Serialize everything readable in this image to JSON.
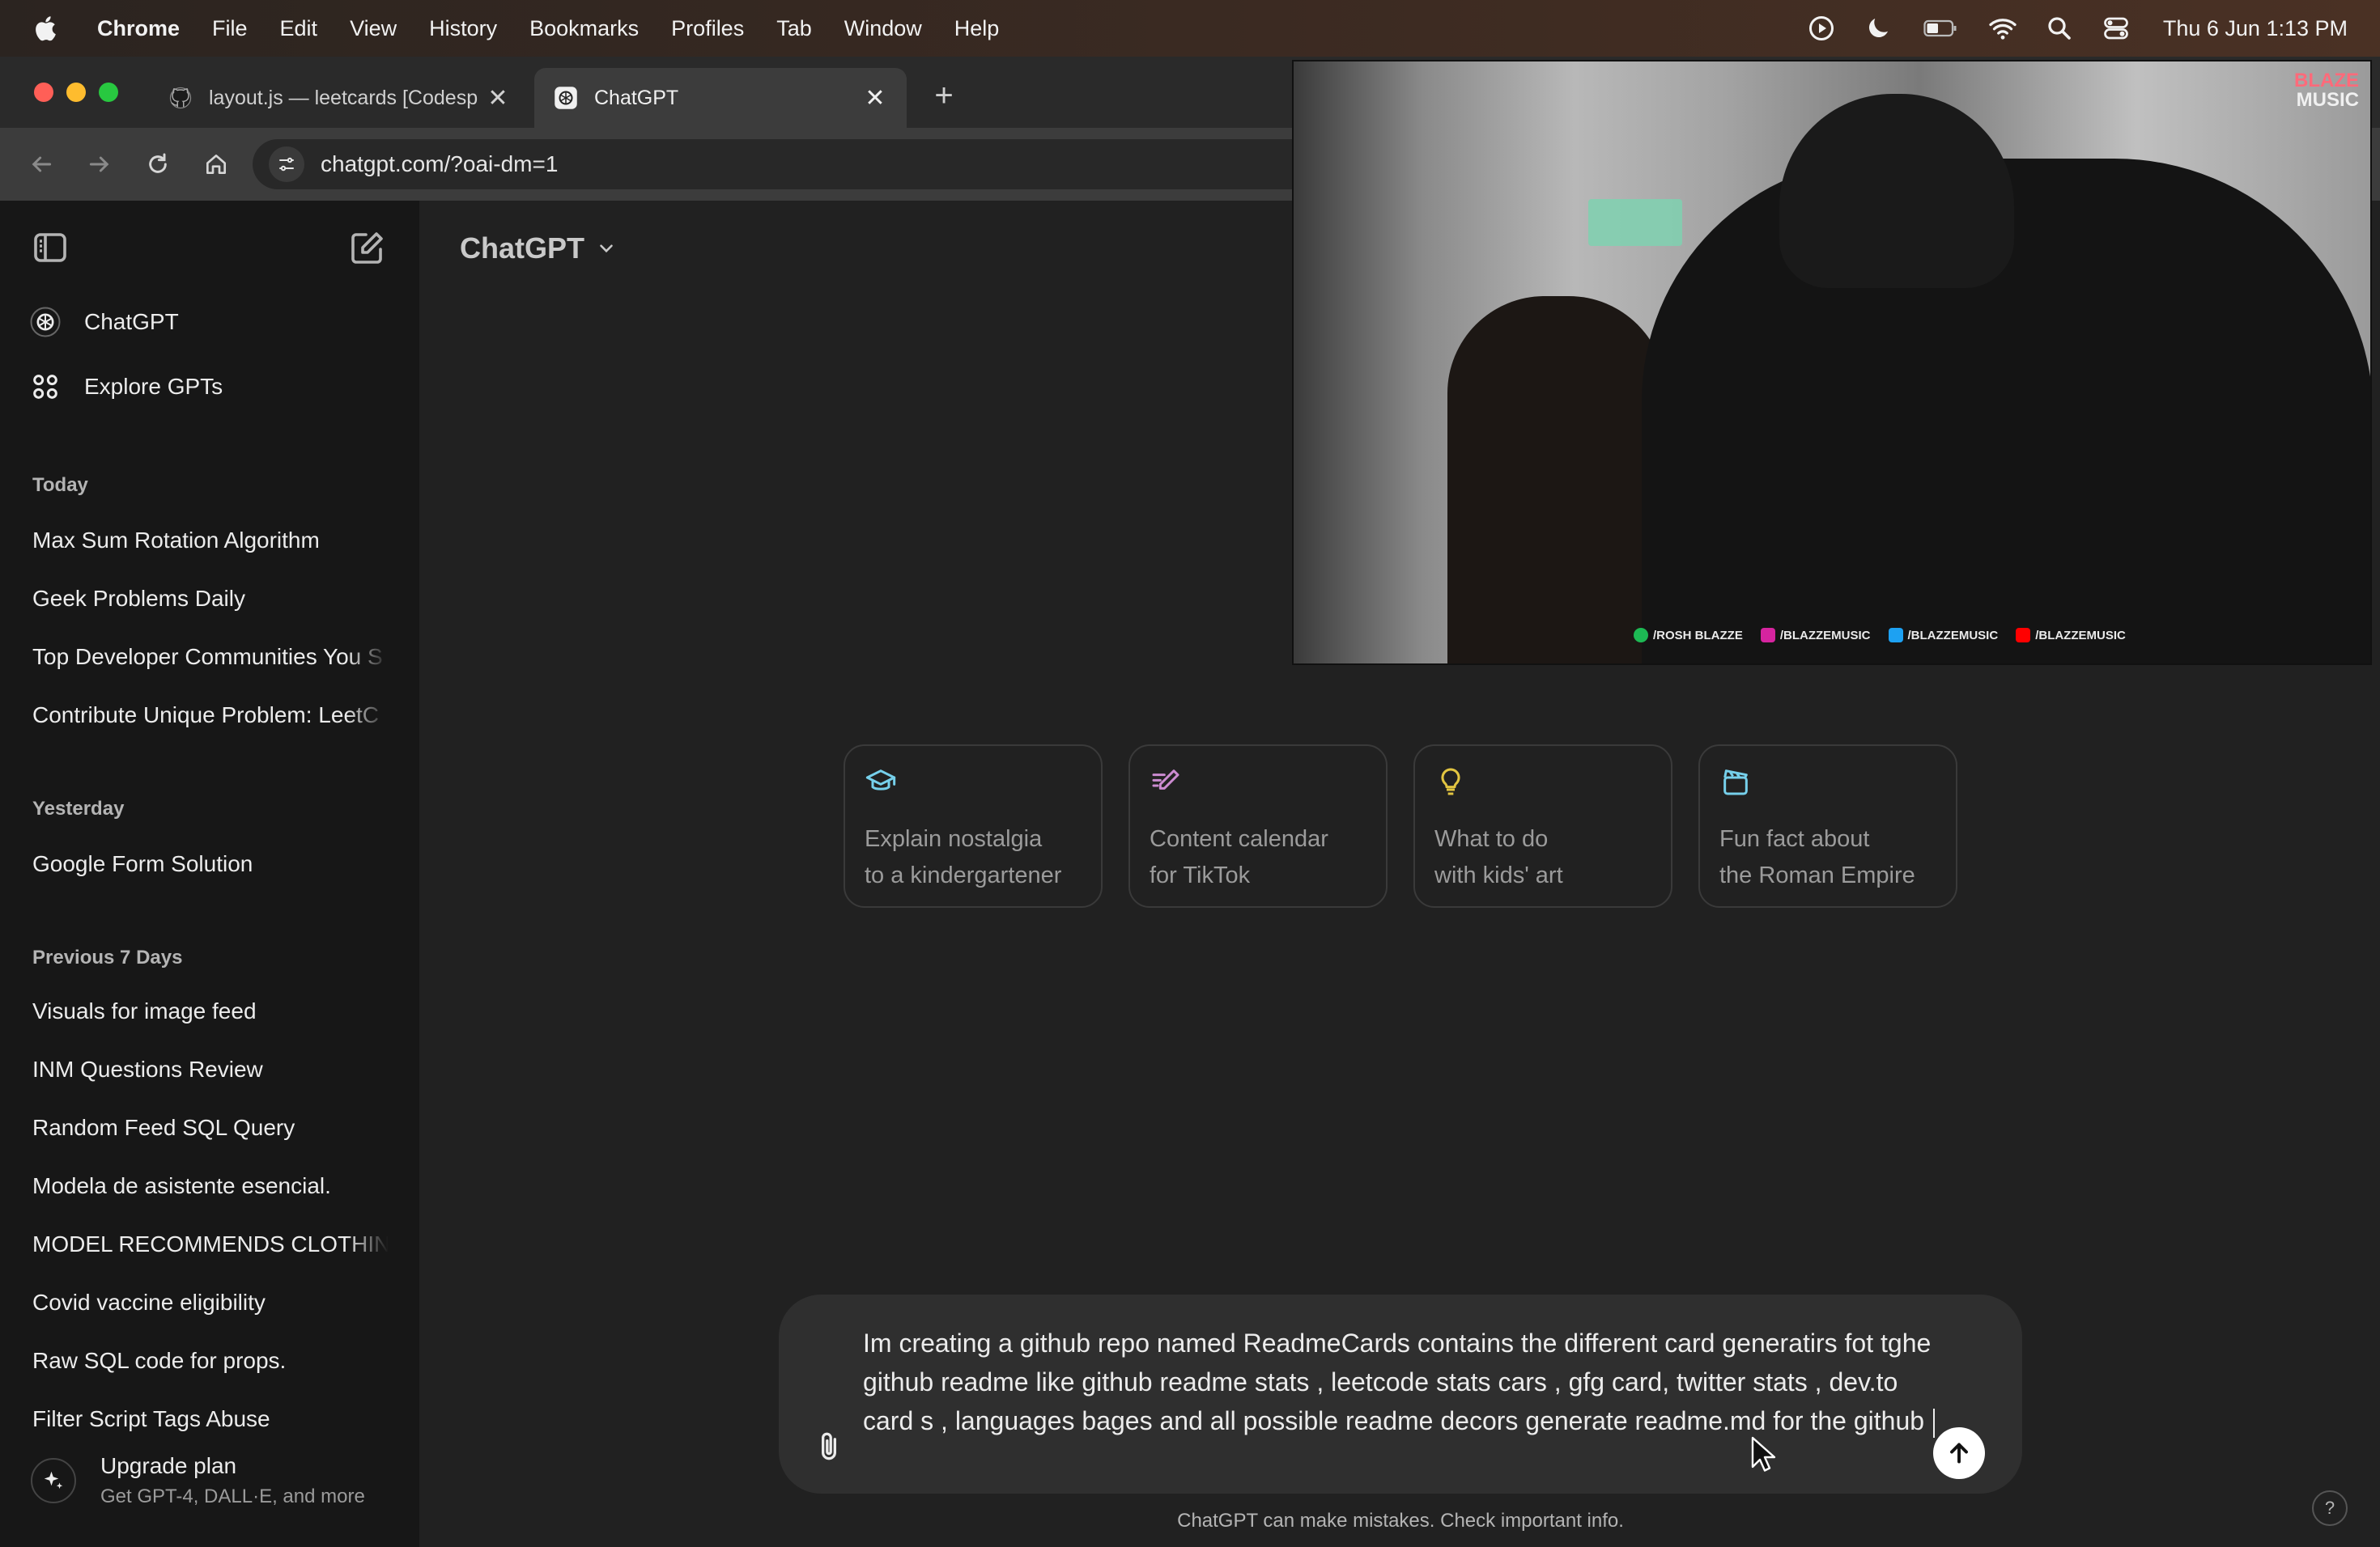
{
  "menubar": {
    "app": "Chrome",
    "items": [
      "File",
      "Edit",
      "View",
      "History",
      "Bookmarks",
      "Profiles",
      "Tab",
      "Window",
      "Help"
    ],
    "clock": "Thu 6 Jun  1:13 PM"
  },
  "browser": {
    "tabs": [
      {
        "title": "layout.js — leetcards [Codesp",
        "active": false
      },
      {
        "title": "ChatGPT",
        "active": true
      }
    ],
    "url": "chatgpt.com/?oai-dm=1"
  },
  "sidebar": {
    "top_items": [
      {
        "label": "ChatGPT",
        "icon": "openai-logo-icon"
      },
      {
        "label": "Explore GPTs",
        "icon": "grid-icon"
      }
    ],
    "sections": [
      {
        "title": "Today",
        "items": [
          "Max Sum Rotation Algorithm",
          "Geek Problems Daily",
          "Top Developer Communities You S",
          "Contribute Unique Problem: LeetC"
        ]
      },
      {
        "title": "Yesterday",
        "items": [
          "Google Form Solution"
        ]
      },
      {
        "title": "Previous 7 Days",
        "items": [
          "Visuals for image feed",
          "INM Questions Review",
          "Random Feed SQL Query",
          "Modela de asistente esencial.",
          "MODEL RECOMMENDS CLOTHIN",
          "Covid vaccine eligibility",
          "Raw SQL code for props.",
          "Filter Script Tags Abuse"
        ]
      }
    ],
    "upgrade": {
      "title": "Upgrade plan",
      "subtitle": "Get GPT-4, DALL·E, and more"
    }
  },
  "main": {
    "model_label": "ChatGPT",
    "suggestions": [
      {
        "line1": "Explain nostalgia",
        "line2": "to a kindergartener",
        "icon": "graduation-cap-icon",
        "color": "#76d0eb"
      },
      {
        "line1": "Content calendar",
        "line2": "for TikTok",
        "icon": "pen-lines-icon",
        "color": "#cb8bd0"
      },
      {
        "line1": "What to do",
        "line2": "with kids' art",
        "icon": "lightbulb-icon",
        "color": "#e2c541"
      },
      {
        "line1": "Fun fact about",
        "line2": "the Roman Empire",
        "icon": "clapperboard-icon",
        "color": "#76d0eb"
      }
    ],
    "composer_text": "Im creating a github repo named ReadmeCards contains the different card generatirs fot tghe github readme like github readme stats , leetcode stats cars , gfg card, twitter stats , dev.to card s , languages bages and all possible readme decors generate readme.md for the github ",
    "disclaimer": "ChatGPT can make mistakes. Check important info.",
    "help": "?"
  },
  "pip": {
    "logo_line1": "BLAZE",
    "logo_line2": "MUSIC",
    "socials": [
      "/ROSH BLAZZE",
      "/BLAZZEMUSIC",
      "/BLAZZEMUSIC",
      "/BLAZZEMUSIC"
    ]
  }
}
